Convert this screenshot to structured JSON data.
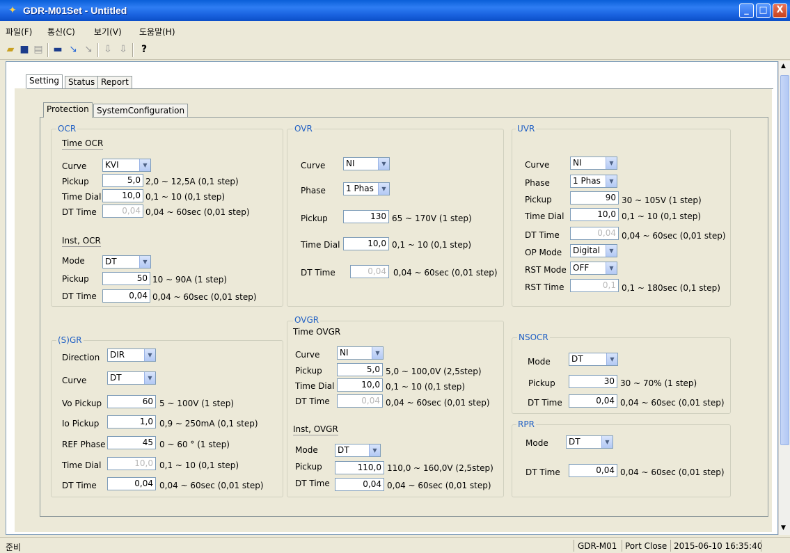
{
  "window": {
    "title": "GDR-M01Set - Untitled",
    "min": "_",
    "max": "□",
    "close": "X"
  },
  "menu": [
    "파일(F)",
    "통신(C)",
    "보기(V)",
    "도움말(H)"
  ],
  "outer_tabs": [
    "Setting",
    "Status",
    "Report"
  ],
  "inner_tabs": [
    "Protection",
    "SystemConfiguration"
  ],
  "ocr": {
    "title": "OCR",
    "time_title": "Time OCR",
    "curve": {
      "label": "Curve",
      "value": "KVI"
    },
    "pickup": {
      "label": "Pickup",
      "value": "5,0",
      "range": "2,0 ~ 12,5A (0,1 step)"
    },
    "time_dial": {
      "label": "Time Dial",
      "value": "10,0",
      "range": "0,1 ~ 10 (0,1 step)"
    },
    "dt_time": {
      "label": "DT Time",
      "value": "0,04",
      "range": "0,04 ~ 60sec (0,01 step)"
    },
    "inst_title": "Inst, OCR",
    "mode": {
      "label": "Mode",
      "value": "DT"
    },
    "inst_pickup": {
      "label": "Pickup",
      "value": "50",
      "range": "10 ~ 90A (1 step)"
    },
    "inst_dt": {
      "label": "DT Time",
      "value": "0,04",
      "range": "0,04 ~ 60sec (0,01 step)"
    }
  },
  "ovr": {
    "title": "OVR",
    "curve": {
      "label": "Curve",
      "value": "NI"
    },
    "phase": {
      "label": "Phase",
      "value": "1 Phas"
    },
    "pickup": {
      "label": "Pickup",
      "value": "130",
      "range": "65 ~ 170V (1 step)"
    },
    "time_dial": {
      "label": "Time Dial",
      "value": "10,0",
      "range": "0,1 ~ 10 (0,1 step)"
    },
    "dt_time": {
      "label": "DT Time",
      "value": "0,04",
      "range": "0,04 ~ 60sec (0,01 step)"
    }
  },
  "uvr": {
    "title": "UVR",
    "curve": {
      "label": "Curve",
      "value": "NI"
    },
    "phase": {
      "label": "Phase",
      "value": "1 Phas"
    },
    "pickup": {
      "label": "Pickup",
      "value": "90",
      "range": "30 ~ 105V (1 step)"
    },
    "time_dial": {
      "label": "Time Dial",
      "value": "10,0",
      "range": "0,1 ~ 10 (0,1 step)"
    },
    "dt_time": {
      "label": "DT Time",
      "value": "0,04",
      "range": "0,04 ~ 60sec (0,01 step)"
    },
    "op_mode": {
      "label": "OP Mode",
      "value": "Digital"
    },
    "rst_mode": {
      "label": "RST Mode",
      "value": "OFF"
    },
    "rst_time": {
      "label": "RST Time",
      "value": "0,1",
      "range": "0,1 ~ 180sec (0,1 step)"
    }
  },
  "sgr": {
    "title": "(S)GR",
    "direction": {
      "label": "Direction",
      "value": "DIR"
    },
    "curve": {
      "label": "Curve",
      "value": "DT"
    },
    "vo_pickup": {
      "label": "Vo Pickup",
      "value": "60",
      "range": "5 ~ 100V (1 step)"
    },
    "io_pickup": {
      "label": "Io Pickup",
      "value": "1,0",
      "range": "0,9 ~ 250mA (0,1 step)"
    },
    "ref_phase": {
      "label": "REF Phase",
      "value": "45",
      "range": "0 ~ 60 ° (1 step)"
    },
    "time_dial": {
      "label": "Time Dial",
      "value": "10,0",
      "range": "0,1 ~ 10 (0,1 step)"
    },
    "dt_time": {
      "label": "DT Time",
      "value": "0,04",
      "range": "0,04 ~ 60sec (0,01 step)"
    }
  },
  "ovgr": {
    "title": "OVGR",
    "time_title": "Time OVGR",
    "curve": {
      "label": "Curve",
      "value": "NI"
    },
    "pickup": {
      "label": "Pickup",
      "value": "5,0",
      "range": "5,0 ~ 100,0V (2,5step)"
    },
    "time_dial": {
      "label": "Time Dial",
      "value": "10,0",
      "range": "0,1 ~ 10 (0,1 step)"
    },
    "dt_time": {
      "label": "DT Time",
      "value": "0,04",
      "range": "0,04 ~ 60sec (0,01 step)"
    },
    "inst_title": "Inst, OVGR",
    "mode": {
      "label": "Mode",
      "value": "DT"
    },
    "inst_pickup": {
      "label": "Pickup",
      "value": "110,0",
      "range": "110,0 ~ 160,0V (2,5step)"
    },
    "inst_dt": {
      "label": "DT Time",
      "value": "0,04",
      "range": "0,04 ~ 60sec (0,01 step)"
    }
  },
  "nsocr": {
    "title": "NSOCR",
    "mode": {
      "label": "Mode",
      "value": "DT"
    },
    "pickup": {
      "label": "Pickup",
      "value": "30",
      "range": "30 ~ 70% (1 step)"
    },
    "dt_time": {
      "label": "DT Time",
      "value": "0,04",
      "range": "0,04 ~ 60sec (0,01 step)"
    }
  },
  "rpr": {
    "title": "RPR",
    "mode": {
      "label": "Mode",
      "value": "DT"
    },
    "dt_time": {
      "label": "DT Time",
      "value": "0,04",
      "range": "0,04 ~ 60sec (0,01 step)"
    }
  },
  "status": {
    "left": "준비",
    "device": "GDR-M01",
    "port": "Port Close",
    "datetime": "2015-06-10 16:35:40"
  },
  "icons": [
    "open-icon",
    "save-icon",
    "new-icon",
    "connect-icon",
    "link-icon",
    "unlink-icon",
    "download-icon",
    "upload-icon",
    "help-icon"
  ]
}
